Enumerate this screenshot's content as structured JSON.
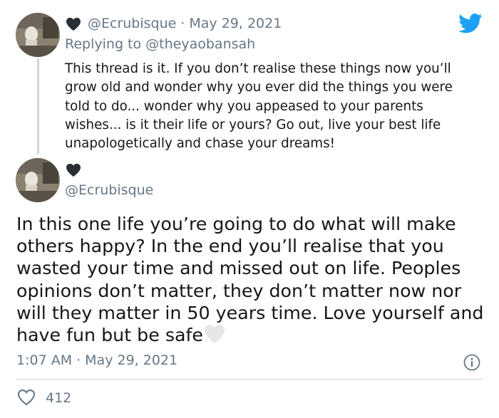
{
  "reply_tweet": {
    "handle": "@Ecrubisque",
    "separator": "·",
    "date": "May 29, 2021",
    "replying_prefix": "Replying to",
    "replying_to": "@theyaobansah",
    "text": "This thread is it. If you don’t realise these things now you’ll grow old and wonder why you ever did the things you were told to do... wonder why you appeased to your parents wishes... is it their life or yours? Go out, live your best life unapologetically and chase your dreams!"
  },
  "main_tweet": {
    "handle": "@Ecrubisque",
    "text": "In this one life you’re going to do what will make others happy? In the end you’ll realise that you wasted your time and missed out on life. Peoples opinions don’t matter, they don’t matter now nor will they matter in 50 years time. Love yourself and have fun but be safe",
    "time": "1:07 AM",
    "separator": "·",
    "date": "May 29, 2021",
    "likes": "412"
  },
  "icons": {
    "name_heart": "black-heart-icon",
    "emoji_heart": "white-heart-icon",
    "brand": "twitter-bird-icon",
    "info": "info-icon",
    "like": "heart-outline-icon"
  },
  "colors": {
    "text": "#14171a",
    "secondary": "#657786",
    "brand_blue": "#1da1f2",
    "thread_line": "#ccd6dd"
  }
}
